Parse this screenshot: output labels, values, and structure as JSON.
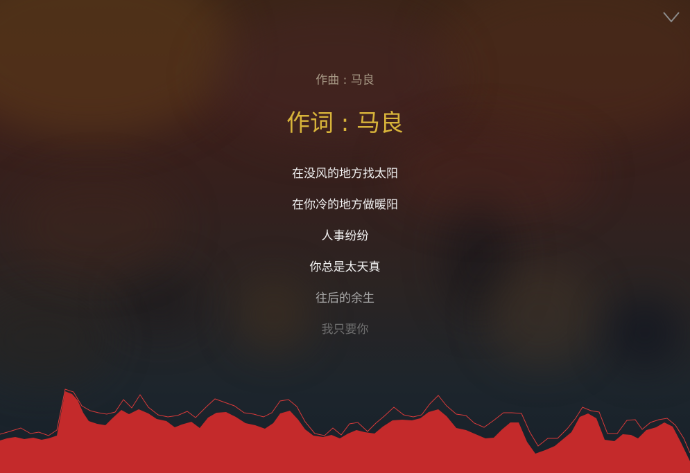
{
  "lyrics": {
    "composer": "作曲 : 马良",
    "current": "作词 : 马良",
    "lines": [
      "在没风的地方找太阳",
      "在你冷的地方做暖阳",
      "人事纷纷",
      "你总是太天真",
      "往后的余生",
      "我只要你"
    ]
  },
  "icons": {
    "collapse": "chevron-down-icon"
  },
  "colors": {
    "current_line": "#d8b43a",
    "visualizer_fill": "#c42a2b",
    "visualizer_peak": "#d93a3a"
  }
}
